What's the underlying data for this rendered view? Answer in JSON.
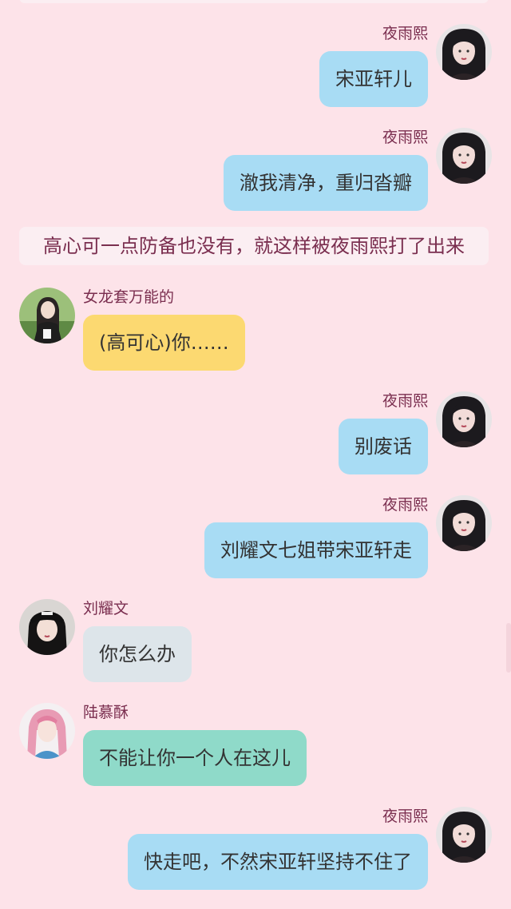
{
  "chat": {
    "narration": "高心可一点防备也没有，就这样被夜雨熙打了出来",
    "messages": [
      {
        "sender": "夜雨熙",
        "text": "宋亚轩儿"
      },
      {
        "sender": "夜雨熙",
        "text": "澈我清净，重归沓瓣"
      },
      {
        "sender": "女龙套万能的",
        "text": "(高可心)你……"
      },
      {
        "sender": "夜雨熙",
        "text": "别废话"
      },
      {
        "sender": "夜雨熙",
        "text": "刘耀文七姐带宋亚轩走"
      },
      {
        "sender": "刘耀文",
        "text": "你怎么办"
      },
      {
        "sender": "陆慕酥",
        "text": "不能让你一个人在这儿"
      },
      {
        "sender": "夜雨熙",
        "text": "快走吧，不然宋亚轩坚持不住了"
      }
    ]
  },
  "colors": {
    "background": "#fde3e9",
    "name_text": "#7a2e4f",
    "bubble_blue": "#a8dcf4",
    "bubble_yellow": "#fcd971",
    "bubble_gray": "#dde5ea",
    "bubble_teal": "#8fdac9"
  },
  "icons": {
    "self_avatar": "dark-haired-girl-avatar",
    "npc_avatar": "girl-outdoors-avatar",
    "liu_avatar": "girl-black-cap-avatar",
    "lu_avatar": "girl-pink-blue-hair-avatar"
  }
}
